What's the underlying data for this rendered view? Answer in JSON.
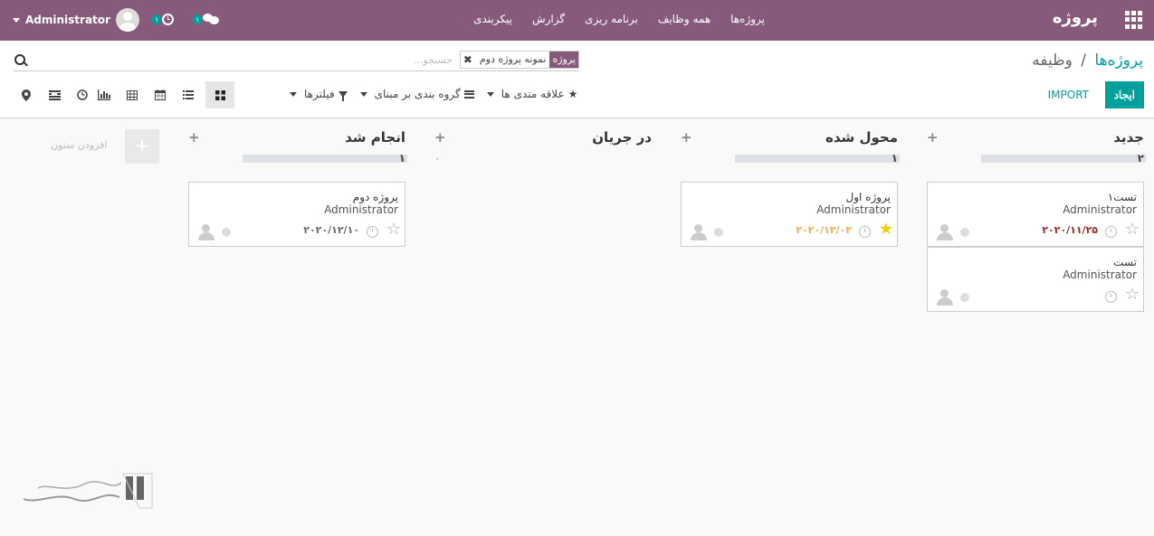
{
  "navbar": {
    "brand": "پروژه",
    "menu": [
      "پروژه‌ها",
      "همه وظایف",
      "برنامه ریزی",
      "گزارش",
      "پیکربندی"
    ],
    "user_name": "Administrator",
    "activity_count": "۱",
    "message_count": "۱"
  },
  "breadcrumb": {
    "parent": "پروژه‌ها",
    "separator": "/",
    "current": "وظیفه"
  },
  "search": {
    "facet_category": "پروژه",
    "facet_value": "نمونه پروژه دوم",
    "placeholder": "جستجو..."
  },
  "buttons": {
    "create": "ایجاد",
    "import": "IMPORT"
  },
  "search_options": {
    "filters": "فیلترها",
    "group_by": "گروه بندی بر مبنای",
    "favorites": "علاقه مندی ها"
  },
  "views": [
    "kanban-view-icon",
    "list-view-icon",
    "calendar-view-icon",
    "pivot-view-icon",
    "graph-view-icon",
    "activity-view-icon",
    "gantt-view-icon",
    "map-view-icon"
  ],
  "kanban": {
    "columns": [
      {
        "title": "جدید",
        "count": "۲",
        "cards": [
          {
            "title": "تست۱",
            "user": "Administrator",
            "date": "۲۰۲۰/۱۱/۲۵",
            "date_color": "#a12525",
            "starred": false
          },
          {
            "title": "تست",
            "user": "Administrator",
            "date": "",
            "starred": false
          }
        ]
      },
      {
        "title": "محول شده",
        "count": "۱",
        "cards": [
          {
            "title": "پروژه اول",
            "user": "Administrator",
            "date": "۲۰۲۰/۱۲/۰۲",
            "date_color": "#f0ad4e",
            "starred": true
          }
        ]
      },
      {
        "title": "در جریان",
        "count": "۰",
        "cards": []
      },
      {
        "title": "انجام شد",
        "count": "۱",
        "cards": [
          {
            "title": "پروژه دوم",
            "user": "Administrator",
            "date": "۲۰۲۰/۱۲/۱۰",
            "date_color": "#666666",
            "starred": false
          }
        ]
      }
    ],
    "add_column_label": "افزودن ستون"
  },
  "colors": {
    "navbar": "#875a7b",
    "primary": "#00a09d",
    "favorite": "#f3cc00"
  }
}
